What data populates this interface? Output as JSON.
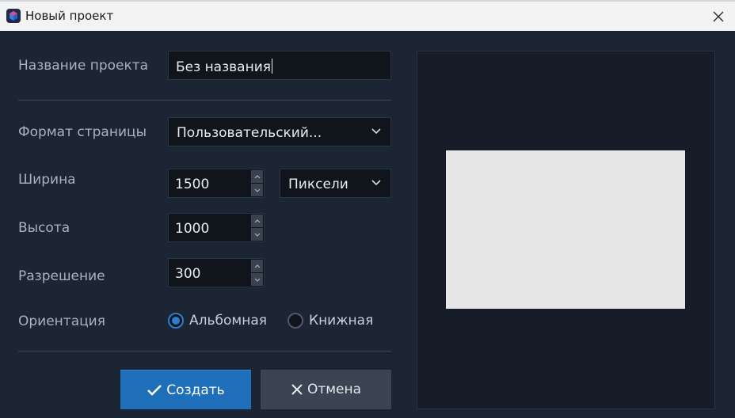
{
  "window": {
    "title": "Новый проект"
  },
  "form": {
    "project_name_label": "Название проекта",
    "project_name_value": "Без названия",
    "page_format_label": "Формат страницы",
    "page_format_value": "Пользовательский...",
    "width_label": "Ширина",
    "width_value": "1500",
    "unit_value": "Пиксели",
    "height_label": "Высота",
    "height_value": "1000",
    "resolution_label": "Разрешение",
    "resolution_value": "300",
    "orientation_label": "Ориентация",
    "orientation_options": [
      {
        "label": "Альбомная",
        "checked": true
      },
      {
        "label": "Книжная",
        "checked": false
      }
    ]
  },
  "buttons": {
    "create_label": "Создать",
    "cancel_label": "Отмена"
  },
  "colors": {
    "background": "#1c2533",
    "accent": "#1f6eb9",
    "page_preview": "#e6e6e6"
  },
  "icons": [
    "app-logo-icon",
    "close-icon",
    "chevron-down-icon",
    "spinner-up-icon",
    "spinner-down-icon",
    "checkmark-icon",
    "x-icon"
  ]
}
